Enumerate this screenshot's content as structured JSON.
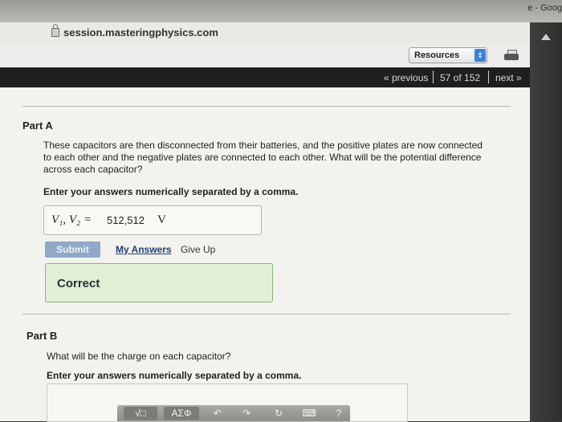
{
  "browser": {
    "tab_fragment": "e - Goog",
    "url": "session.masteringphysics.com"
  },
  "toolbar": {
    "resources_label": "Resources"
  },
  "nav": {
    "previous": "« previous",
    "position": "57 of 152",
    "next": "next »"
  },
  "part_a": {
    "title": "Part A",
    "question_lines": [
      "These capacitors are then disconnected from their batteries, and the positive plates are now connected",
      "to each other and the negative plates are connected to each other. What will be the potential difference",
      "across each capacitor?"
    ],
    "instruction": "Enter your answers numerically separated by a comma.",
    "answer_variables": "V₁, V₂ =",
    "answer_value": "512,512",
    "answer_unit": "V",
    "submit_label": "Submit",
    "my_answers_label": "My Answers",
    "give_up_label": "Give Up",
    "feedback": "Correct"
  },
  "part_b": {
    "title": "Part B",
    "question": "What will be the charge on each capacitor?",
    "instruction": "Enter your answers numerically separated by a comma.",
    "math_toolbar": {
      "template_label": "√□",
      "symbols_label": "ΑΣΦ",
      "help_label": "?"
    }
  }
}
